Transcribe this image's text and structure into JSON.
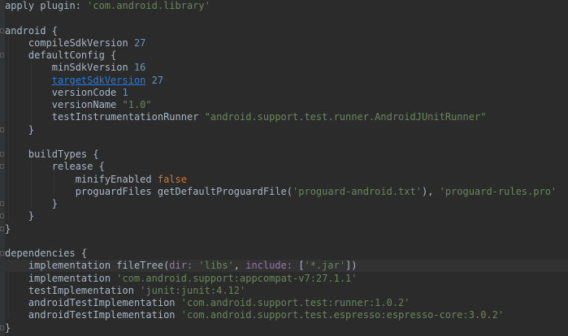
{
  "editor": {
    "theme": {
      "background": "#2b2b2b",
      "text": "#a9b7c6",
      "string": "#6a8759",
      "number": "#6897bb",
      "keyword": "#cc7832",
      "named_arg": "#9876aa",
      "link": "#287bde"
    },
    "lines": [
      [
        {
          "t": "apply plugin: ",
          "k": "plain"
        },
        {
          "t": "'com.android.library'",
          "k": "str"
        }
      ],
      [],
      [
        {
          "t": "android {",
          "k": "plain"
        }
      ],
      [
        {
          "t": "    compileSdkVersion ",
          "k": "plain"
        },
        {
          "t": "27",
          "k": "num"
        }
      ],
      [
        {
          "t": "    defaultConfig {",
          "k": "plain"
        }
      ],
      [
        {
          "t": "        minSdkVersion ",
          "k": "plain"
        },
        {
          "t": "16",
          "k": "num"
        }
      ],
      [
        {
          "t": "        ",
          "k": "ws"
        },
        {
          "t": "targetSdkVersion",
          "k": "link"
        },
        {
          "t": " ",
          "k": "ws"
        },
        {
          "t": "27",
          "k": "num"
        }
      ],
      [
        {
          "t": "        versionCode ",
          "k": "plain"
        },
        {
          "t": "1",
          "k": "num"
        }
      ],
      [
        {
          "t": "        versionName ",
          "k": "plain"
        },
        {
          "t": "\"1.0\"",
          "k": "str"
        }
      ],
      [
        {
          "t": "        testInstrumentationRunner ",
          "k": "plain"
        },
        {
          "t": "\"android.support.test.runner.AndroidJUnitRunner\"",
          "k": "str"
        }
      ],
      [
        {
          "t": "    }",
          "k": "plain"
        }
      ],
      [],
      [
        {
          "t": "    buildTypes {",
          "k": "plain"
        }
      ],
      [
        {
          "t": "        release {",
          "k": "plain"
        }
      ],
      [
        {
          "t": "            minifyEnabled ",
          "k": "plain"
        },
        {
          "t": "false",
          "k": "kw"
        }
      ],
      [
        {
          "t": "            proguardFiles getDefaultProguardFile(",
          "k": "plain"
        },
        {
          "t": "'proguard-android.txt'",
          "k": "str"
        },
        {
          "t": "), ",
          "k": "plain"
        },
        {
          "t": "'proguard-rules.pro'",
          "k": "str"
        }
      ],
      [
        {
          "t": "        }",
          "k": "plain"
        }
      ],
      [
        {
          "t": "    }",
          "k": "plain"
        }
      ],
      [
        {
          "t": "}",
          "k": "plain"
        }
      ],
      [],
      [
        {
          "t": "dependencies {",
          "k": "plain"
        }
      ],
      [
        {
          "t": "    implementation fileTree(",
          "k": "plain"
        },
        {
          "t": "dir: ",
          "k": "named"
        },
        {
          "t": "'libs'",
          "k": "str"
        },
        {
          "t": ", ",
          "k": "plain"
        },
        {
          "t": "include: ",
          "k": "named"
        },
        {
          "t": "[",
          "k": "plain"
        },
        {
          "t": "'*.jar'",
          "k": "str"
        },
        {
          "t": "])",
          "k": "plain"
        }
      ],
      [
        {
          "t": "    implementation ",
          "k": "plain"
        },
        {
          "t": "'com.android.support:appcompat-v7:27.1.1'",
          "k": "str"
        }
      ],
      [
        {
          "t": "    testImplementation ",
          "k": "plain"
        },
        {
          "t": "'junit:junit:4.12'",
          "k": "str"
        }
      ],
      [
        {
          "t": "    androidTestImplementation ",
          "k": "plain"
        },
        {
          "t": "'com.android.support.test:runner:1.0.2'",
          "k": "str"
        }
      ],
      [
        {
          "t": "    androidTestImplementation ",
          "k": "plain"
        },
        {
          "t": "'com.android.support.test.espresso:espresso-core:3.0.2'",
          "k": "str"
        }
      ],
      [
        {
          "t": "}",
          "k": "plain"
        }
      ]
    ],
    "current_line": 21,
    "fold_markers": [
      2,
      4,
      10,
      12,
      13,
      16,
      17,
      18,
      20,
      26
    ]
  }
}
